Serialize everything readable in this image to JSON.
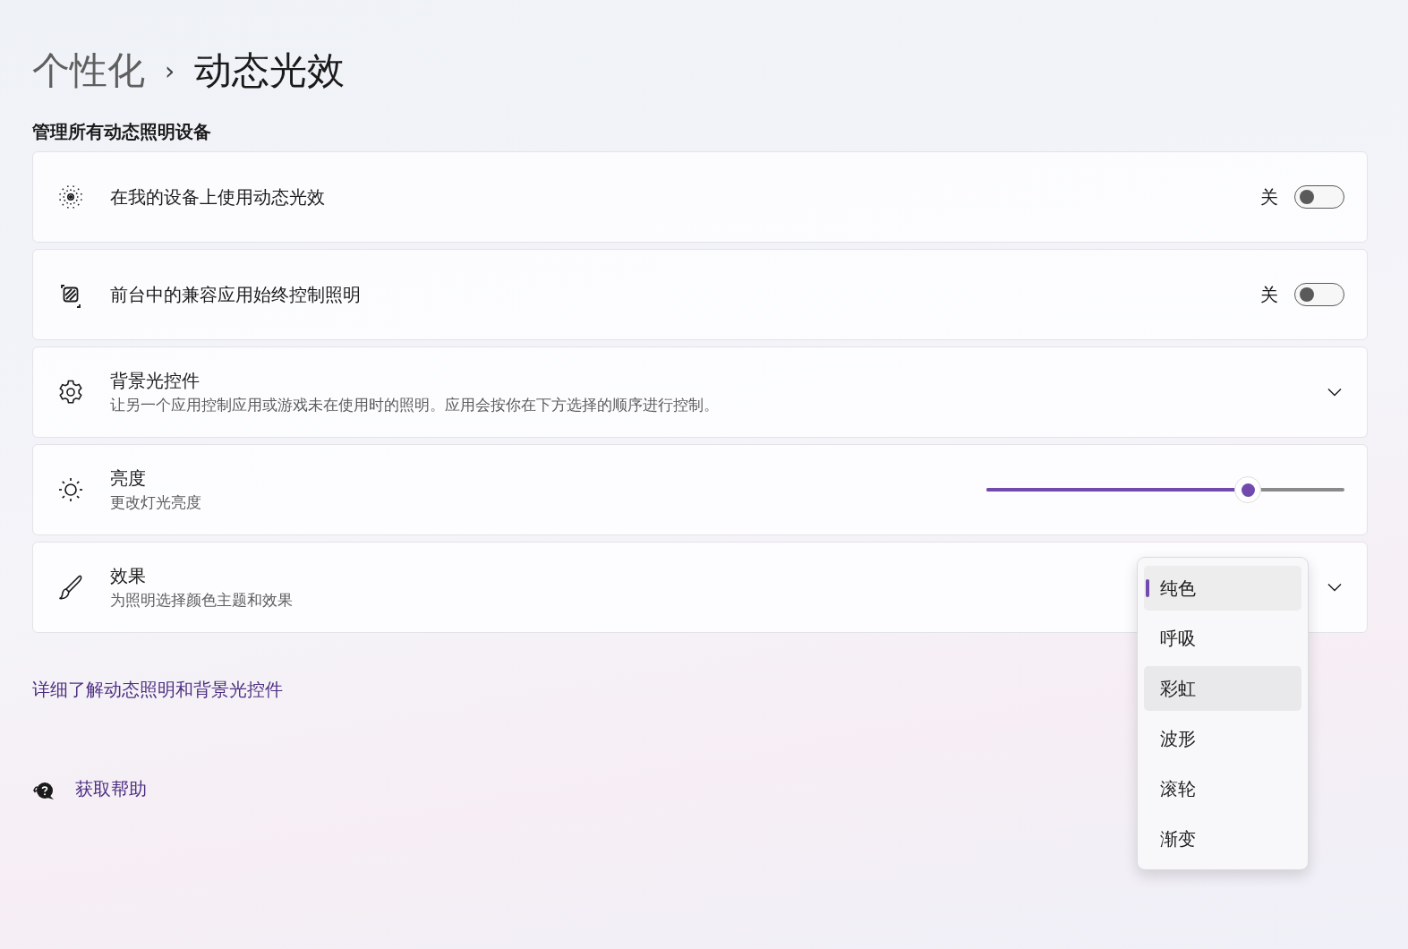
{
  "breadcrumb": {
    "parent": "个性化",
    "separator": "›",
    "current": "动态光效"
  },
  "section_title": "管理所有动态照明设备",
  "settings": [
    {
      "kind": "toggle",
      "title": "在我的设备上使用动态光效",
      "state_label": "关",
      "on": false
    },
    {
      "kind": "toggle",
      "title": "前台中的兼容应用始终控制照明",
      "state_label": "关",
      "on": false
    },
    {
      "kind": "expander",
      "title": "背景光控件",
      "description": "让另一个应用控制应用或游戏未在使用时的照明。应用会按你在下方选择的顺序进行控制。",
      "expanded": false
    },
    {
      "kind": "slider",
      "title": "亮度",
      "description": "更改灯光亮度",
      "level": 0.73
    },
    {
      "kind": "dropdown",
      "title": "效果",
      "description": "为照明选择颜色主题和效果",
      "expanded": false,
      "options": [
        {
          "label": "纯色",
          "selected": true,
          "hovered": false
        },
        {
          "label": "呼吸",
          "selected": false,
          "hovered": false
        },
        {
          "label": "彩虹",
          "selected": false,
          "hovered": true
        },
        {
          "label": "波形",
          "selected": false,
          "hovered": false
        },
        {
          "label": "滚轮",
          "selected": false,
          "hovered": false
        },
        {
          "label": "渐变",
          "selected": false,
          "hovered": false
        }
      ]
    }
  ],
  "learn_more_link": "详细了解动态照明和背景光控件",
  "help_link": "获取帮助"
}
